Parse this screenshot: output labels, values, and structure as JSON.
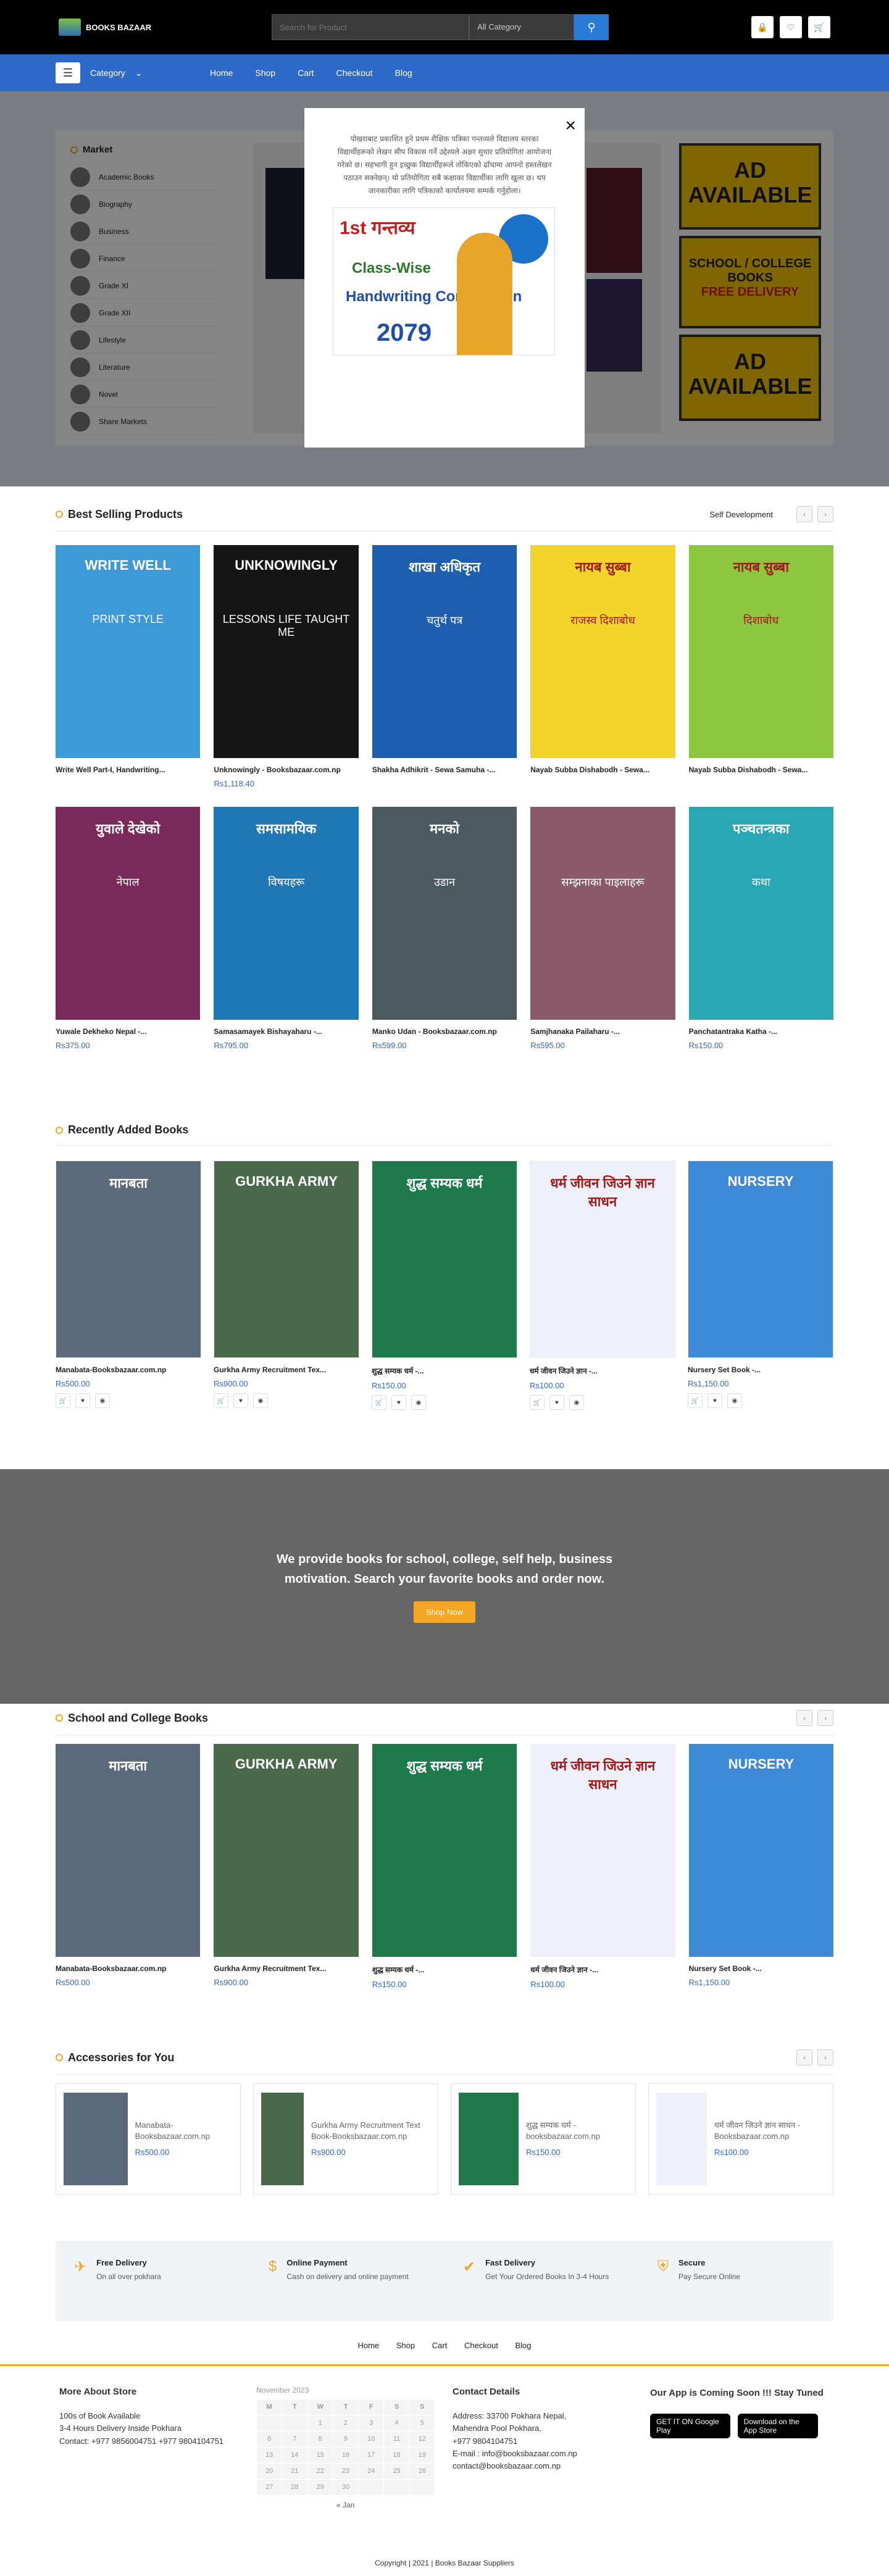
{
  "header": {
    "brand": "BOOKS BAZAAR",
    "search_placeholder": "Search for Product",
    "category_select": "All Category"
  },
  "nav": {
    "category_label": "Category",
    "links": [
      "Home",
      "Shop",
      "Cart",
      "Checkout",
      "Blog"
    ]
  },
  "market": {
    "title": "Market",
    "items": [
      "Academic Books",
      "Biography",
      "Business",
      "Finance",
      "Grade XI",
      "Grade XII",
      "Lifestyle",
      "Literature",
      "Novel",
      "Share Markets"
    ]
  },
  "ads": {
    "ad1": "AD AVAILABLE",
    "school1": "SCHOOL / COLLEGE",
    "school2": "BOOKS",
    "school3": "FREE DELIVERY",
    "ad2": "AD AVAILABLE"
  },
  "modal": {
    "text": "पोखराबाट प्रकाशित हुने प्रथम शैक्षिक पत्रिका गन्तव्यले विद्यालय स्तरका विद्यार्थीहरूको लेखन सीप विकास गर्ने उद्देश्यले अक्षर सुधार प्रतियोगिता आयोजना गरेको छ। सहभागी हुन इच्छुक विद्यार्थीहरूले तोकिएको ढाँचामा आफ्नो हस्तलेखन पठाउन सक्नेछन्। यो प्रतियोगिता सबै कक्षाका विद्यार्थीका लागि खुला छ। थप जानकारीका लागि पत्रिकाको कार्यालयमा सम्पर्क गर्नुहोला।",
    "poster_a": "1st गन्तव्य",
    "poster_c": "Class-Wise",
    "poster_d": "Handwriting Competition",
    "poster_e": "2079",
    "close": "×"
  },
  "best_selling": {
    "title": "Best Selling Products",
    "filter": "Self Development",
    "products": [
      {
        "title": "Write Well Part-I, Handwriting...",
        "price": "",
        "cover_title": "WRITE WELL",
        "cover_sub": "PRINT STYLE",
        "bg": "#3d9ad6"
      },
      {
        "title": "Unknowingly - Booksbazaar.com.np",
        "price": "Rs1,118.40",
        "cover_title": "UNKNOWINGLY",
        "cover_sub": "LESSONS LIFE TAUGHT ME",
        "bg": "#151515"
      },
      {
        "title": "Shakha Adhikrit - Sewa Samuha -...",
        "price": "",
        "cover_title": "शाखा अधिकृत",
        "cover_sub": "चतुर्थ पत्र",
        "bg": "#1d5fae"
      },
      {
        "title": "Nayab Subba Dishabodh - Sewa...",
        "price": "",
        "cover_title": "नायब सुब्बा",
        "cover_sub": "राजस्व दिशाबोध",
        "bg": "#f2d42a"
      },
      {
        "title": "Nayab Subba Dishabodh - Sewa...",
        "price": "",
        "cover_title": "नायब सुब्बा",
        "cover_sub": "दिशाबोध",
        "bg": "#8dc63f"
      },
      {
        "title": "Yuwale Dekheko Nepal -...",
        "price": "Rs375.00",
        "cover_title": "युवाले देखेको",
        "cover_sub": "नेपाल",
        "bg": "#7a2a5a"
      },
      {
        "title": "Samasamayek Bishayaharu -...",
        "price": "Rs795.00",
        "cover_title": "समसामयिक",
        "cover_sub": "विषयहरू",
        "bg": "#1f78b4"
      },
      {
        "title": "Manko Udan - Booksbazaar.com.np",
        "price": "Rs599.00",
        "cover_title": "मनको",
        "cover_sub": "उडान",
        "bg": "#4b5a5e"
      },
      {
        "title": "Samjhanaka Pailaharu -...",
        "price": "Rs595.00",
        "cover_title": "",
        "cover_sub": "सम्झनाका पाइलाहरू",
        "bg": "#8a5a6a"
      },
      {
        "title": "Panchatantraka Katha -...",
        "price": "Rs150.00",
        "cover_title": "पञ्चतन्त्रका",
        "cover_sub": "कथा",
        "bg": "#2aa7b5"
      }
    ]
  },
  "recent": {
    "title": "Recently Added Books",
    "products": [
      {
        "title": "Manabata-Booksbazaar.com.np",
        "price": "Rs500.00",
        "cover_title": "मानबता",
        "bg": "#5a6a7a"
      },
      {
        "title": "Gurkha Army Recruitment Tex...",
        "price": "Rs900.00",
        "cover_title": "GURKHA ARMY",
        "bg": "#4b6a4b"
      },
      {
        "title": "शुद्ध सम्यक धर्म -...",
        "price": "Rs150.00",
        "cover_title": "शुद्ध सम्यक धर्म",
        "bg": "#1f7a4b"
      },
      {
        "title": "धर्म जीवन जिउने ज्ञान -...",
        "price": "Rs100.00",
        "cover_title": "धर्म जीवन जिउने ज्ञान साधन",
        "bg": "#eef0fa"
      },
      {
        "title": "Nursery Set Book -...",
        "price": "Rs1,150.00",
        "cover_title": "NURSERY",
        "bg": "#3d8ad6"
      }
    ]
  },
  "promo": {
    "line1": "We provide books for school, college, self help, business",
    "line2": "motivation. Search your favorite books and order now.",
    "button": "Shop Now"
  },
  "school": {
    "title": "School and College Books",
    "products": [
      {
        "title": "Manabata-Booksbazaar.com.np",
        "price": "Rs500.00",
        "cover_title": "मानबता",
        "bg": "#5a6a7a"
      },
      {
        "title": "Gurkha Army Recruitment Tex...",
        "price": "Rs900.00",
        "cover_title": "GURKHA ARMY",
        "bg": "#4b6a4b"
      },
      {
        "title": "शुद्ध सम्यक धर्म -...",
        "price": "Rs150.00",
        "cover_title": "शुद्ध सम्यक धर्म",
        "bg": "#1f7a4b"
      },
      {
        "title": "धर्म जीवन जिउने ज्ञान -...",
        "price": "Rs100.00",
        "cover_title": "धर्म जीवन जिउने ज्ञान साधन",
        "bg": "#eef0fa"
      },
      {
        "title": "Nursery Set Book -...",
        "price": "Rs1,150.00",
        "cover_title": "NURSERY",
        "bg": "#3d8ad6"
      }
    ]
  },
  "accessories": {
    "title": "Accessories for You",
    "items": [
      {
        "title": "Manabata-Booksbazaar.com.np",
        "price": "Rs500.00",
        "bg": "#5a6a7a"
      },
      {
        "title": "Gurkha Army Recruitment Text Book-Booksbazaar.com.np",
        "price": "Rs900.00",
        "bg": "#4b6a4b"
      },
      {
        "title": "शुद्ध सम्यक धर्म - booksbazaar.com.np",
        "price": "Rs150.00",
        "bg": "#1f7a4b"
      },
      {
        "title": "धर्म जीवन जिउने ज्ञान साधन - Booksbazaar.com.np",
        "price": "Rs100.00",
        "bg": "#eef0fa"
      }
    ]
  },
  "features": [
    {
      "title": "Free Delivery",
      "text": "On all over pokhara",
      "icon": "plane-icon"
    },
    {
      "title": "Online Payment",
      "text": "Cash on delivery and online payment",
      "icon": "dollar-icon"
    },
    {
      "title": "Fast Delivery",
      "text": "Get Your Ordered Books In 3-4 Hours",
      "icon": "check-icon"
    },
    {
      "title": "Secure",
      "text": "Pay Secure Online",
      "icon": "shield-icon"
    }
  ],
  "footer": {
    "links": [
      "Home",
      "Shop",
      "Cart",
      "Checkout",
      "Blog"
    ],
    "about_title": "More About Store",
    "about_lines": [
      "100s of Book Available",
      "3-4 Hours Delivery Inside Pokhara",
      "Contact: +977 9856004751 +977 9804104751"
    ],
    "calendar_title": "November 2023",
    "calendar_days": [
      "M",
      "T",
      "W",
      "T",
      "F",
      "S",
      "S"
    ],
    "calendar_rows": [
      [
        "",
        "",
        "1",
        "2",
        "3",
        "4",
        "5"
      ],
      [
        "6",
        "7",
        "8",
        "9",
        "10",
        "11",
        "12"
      ],
      [
        "13",
        "14",
        "15",
        "16",
        "17",
        "18",
        "19"
      ],
      [
        "20",
        "21",
        "22",
        "23",
        "24",
        "25",
        "26"
      ],
      [
        "27",
        "28",
        "29",
        "30",
        "",
        "",
        ""
      ]
    ],
    "calendar_prev": "« Jan",
    "contact_title": "Contact Details",
    "contact_lines": [
      "Address: 33700 Pokhara Nepal,",
      "Mahendra Pool Pokhara,",
      "+977 9804104751",
      "E-mail : info@booksbazaar.com.np",
      "contact@booksbazaar.com.np"
    ],
    "app_title": "Our App is Coming Soon !!! Stay Tuned",
    "google_play": "GET IT ON Google Play",
    "app_store": "Download on the App Store",
    "copyright": "Copyright | 2021 | Books Bazaar Suppliers"
  },
  "colors": {
    "accent": "#f5a623",
    "primary": "#2d6ac7",
    "price": "#2d6ac7"
  }
}
